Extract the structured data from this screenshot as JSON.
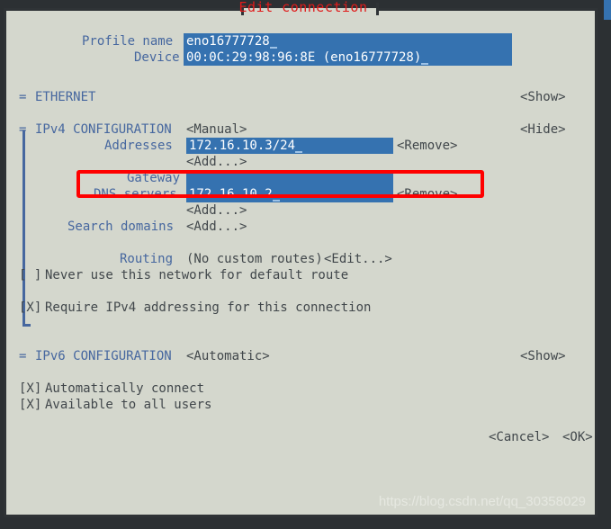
{
  "window": {
    "title": "Edit connection",
    "title_color": "#e01b1b",
    "background": "#d4d7cd",
    "border_color": "#2f3336",
    "label_color": "#46679f",
    "text_color": "#41474b",
    "field_bg": "#3572b0",
    "field_fg": "#ffffff",
    "annotation_color": "#ff0000"
  },
  "header": {
    "profile_name_label": "Profile name",
    "profile_name_value": "eno16777728",
    "device_label": "Device",
    "device_value": "00:0C:29:98:96:8E (eno16777728)"
  },
  "ethernet": {
    "marker": "=",
    "title": "ETHERNET",
    "toggle": "<Show>"
  },
  "ipv4": {
    "marker": "=",
    "title": "IPv4 CONFIGURATION",
    "mode": "<Manual>",
    "toggle": "<Hide>",
    "addresses_label": "Addresses",
    "addresses_value": "172.16.10.3/24",
    "addresses_remove": "<Remove>",
    "addresses_add": "<Add...>",
    "gateway_label": "Gateway",
    "gateway_value": "",
    "dns_label": "DNS servers",
    "dns_value": "172.16.10.2",
    "dns_remove": "<Remove>",
    "dns_add": "<Add...>",
    "search_domains_label": "Search domains",
    "search_domains_add": "<Add...>",
    "routing_label": "Routing",
    "routing_value": "(No custom routes)",
    "routing_edit": "<Edit...>",
    "never_default_checkbox": "[ ]",
    "never_default_label": "Never use this network for default route",
    "require_ipv4_checkbox": "[X]",
    "require_ipv4_label": "Require IPv4 addressing for this connection"
  },
  "ipv6": {
    "marker": "=",
    "title": "IPv6 CONFIGURATION",
    "mode": "<Automatic>",
    "toggle": "<Show>"
  },
  "options": {
    "auto_connect_checkbox": "[X]",
    "auto_connect_label": "Automatically connect",
    "all_users_checkbox": "[X]",
    "all_users_label": "Available to all users"
  },
  "buttons": {
    "cancel": "<Cancel>",
    "ok": "<OK>"
  },
  "watermark": {
    "text": "https://blog.csdn.net/qq_30358029"
  }
}
